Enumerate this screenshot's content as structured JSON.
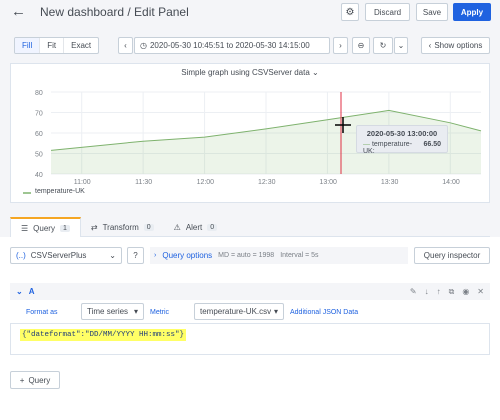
{
  "header": {
    "title": "New dashboard / Edit Panel",
    "discard_label": "Discard",
    "save_label": "Save",
    "apply_label": "Apply"
  },
  "toolbar": {
    "views": [
      "Fill",
      "Fit",
      "Exact"
    ],
    "time_range": "2020-05-30 10:45:51 to 2020-05-30 14:15:00",
    "show_options_label": "Show options"
  },
  "panel": {
    "title": "Simple graph using CSVServer data",
    "legend_label": "temperature-UK",
    "tooltip_time": "2020-05-30 13:00:00",
    "tooltip_series": "temperature-UK:",
    "tooltip_value": "66.50",
    "line_color": "#7eb26d"
  },
  "chart_data": {
    "type": "line",
    "x": [
      "10:45",
      "11:30",
      "12:00",
      "12:30",
      "13:00",
      "13:30",
      "14:00",
      "14:15"
    ],
    "series": [
      {
        "name": "temperature-UK",
        "values": [
          51.5,
          56,
          58,
          62,
          66.5,
          71,
          65,
          61
        ]
      }
    ],
    "x_ticks": [
      "11:00",
      "11:30",
      "12:00",
      "12:30",
      "13:00",
      "13:30",
      "14:00"
    ],
    "y_ticks": [
      "40",
      "50",
      "60",
      "70",
      "80"
    ],
    "ylim": [
      40,
      80
    ]
  },
  "tabs": [
    {
      "label": "Query",
      "count": "1"
    },
    {
      "label": "Transform",
      "count": "0"
    },
    {
      "label": "Alert",
      "count": "0"
    }
  ],
  "query": {
    "datasource": "CSVServerPlus",
    "query_options_label": "Query options",
    "md_text": "MD = auto = 1998",
    "interval_text": "Interval = 5s",
    "inspector_label": "Query inspector",
    "row_letter": "A",
    "format_as_label": "Format as",
    "format_as_value": "Time series",
    "metric_label": "Metric",
    "metric_value": "temperature-UK.csv",
    "json_label": "Additional JSON Data",
    "json_value": "{\"dateformat\":\"DD/MM/YYYY HH:mm:ss\"}",
    "add_query_label": "Query"
  }
}
